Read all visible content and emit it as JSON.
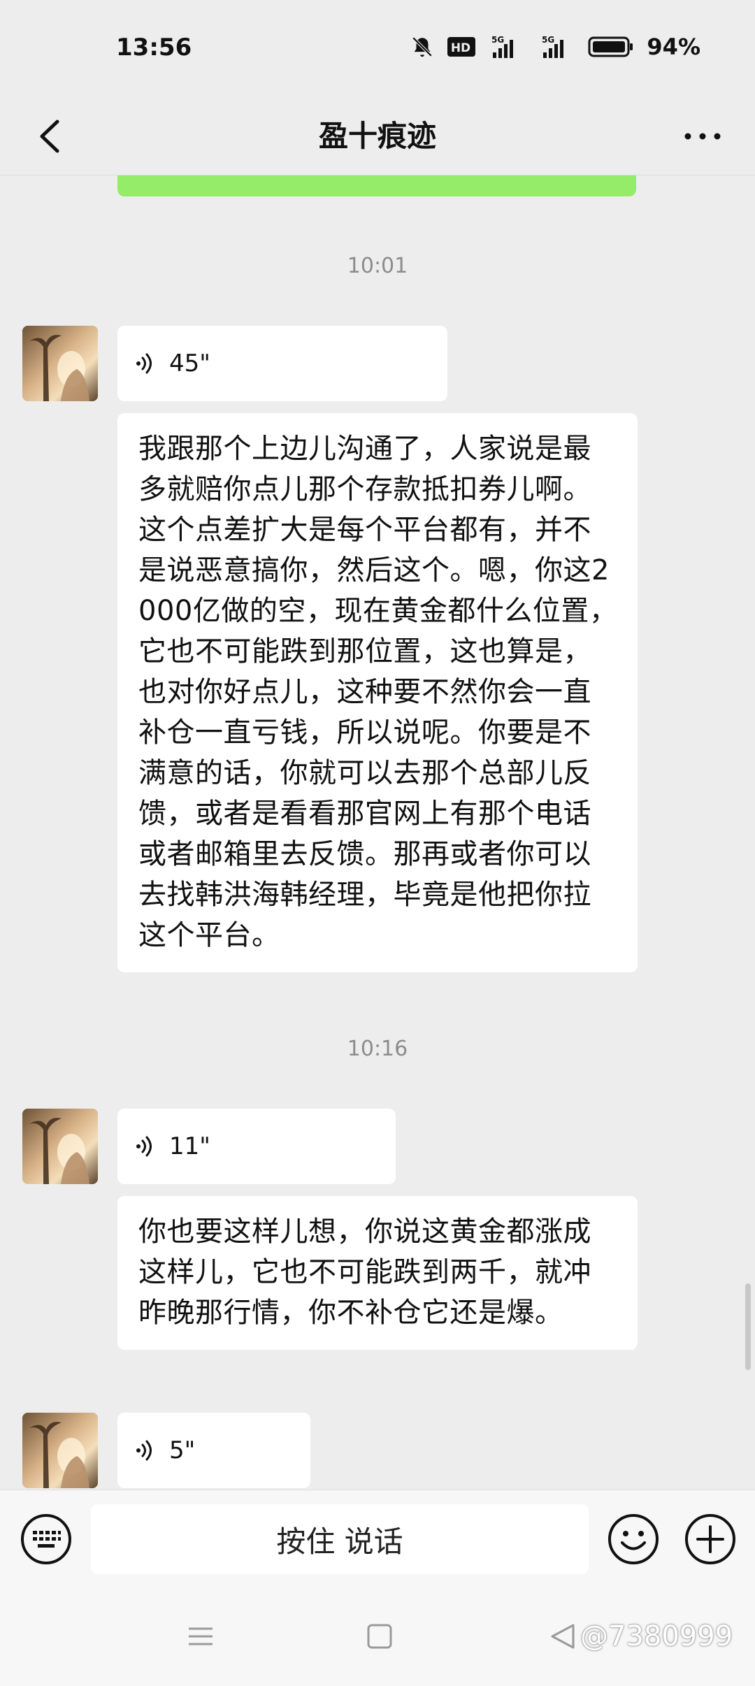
{
  "status_bar": {
    "time": "13:56",
    "battery_percent": "94%",
    "icons": [
      "bell-off-icon",
      "hd-icon",
      "5g-signal-icon",
      "5g-signal-icon",
      "battery-icon"
    ]
  },
  "header": {
    "title": "盈十痕迹",
    "back_icon": "chevron-left-icon",
    "more_icon": "more-dots-icon"
  },
  "messages": {
    "time1": "10:01",
    "voice1_duration": "45\"",
    "text1": "我跟那个上边儿沟通了，人家说是最多就赔你点儿那个存款抵扣券儿啊。这个点差扩大是每个平台都有，并不是说恶意搞你，然后这个。嗯，你这2000亿做的空，现在黄金都什么位置，它也不可能跌到那位置，这也算是，也对你好点儿，这种要不然你会一直补仓一直亏钱，所以说呢。你要是不满意的话，你就可以去那个总部儿反馈，或者是看看那官网上有那个电话或者邮箱里去反馈。那再或者你可以去找韩洪海韩经理，毕竟是他把你拉这个平台。",
    "time2": "10:16",
    "voice2_duration": "11\"",
    "text2": "你也要这样儿想，你说这黄金都涨成这样儿，它也不可能跌到两千，就冲昨晚那行情，你不补仓它还是爆。",
    "voice3_duration": "5\""
  },
  "input_bar": {
    "hold_to_talk": "按住 说话"
  },
  "watermark": {
    "text": "@7380999"
  },
  "colors": {
    "background": "#ededed",
    "sent_bubble": "#95ec69",
    "received_bubble": "#ffffff"
  }
}
